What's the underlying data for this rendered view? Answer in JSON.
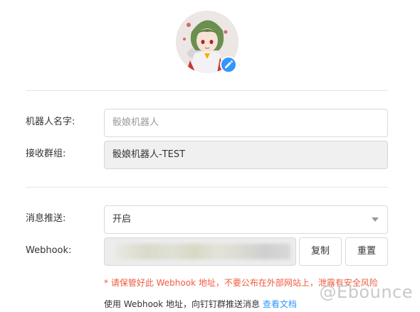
{
  "avatar": {
    "icon": "robot-avatar",
    "edit_icon": "pencil-icon"
  },
  "form": {
    "name": {
      "label": "机器人名字:",
      "placeholder": "骰娘机器人",
      "value": ""
    },
    "group": {
      "label": "接收群组:",
      "value": "骰娘机器人-TEST"
    },
    "push": {
      "label": "消息推送:",
      "value": "开启"
    },
    "webhook": {
      "label": "Webhook:",
      "copy_label": "复制",
      "reset_label": "重置",
      "warning": "* 请保管好此 Webhook 地址，不要公布在外部网站上，泄露有安全风险",
      "hint_prefix": "使用 Webhook 地址，向钉钉群推送消息 ",
      "hint_link": "查看文档"
    }
  },
  "watermark": "@Ebounce",
  "colors": {
    "accent": "#3296fa",
    "warning": "#f05b3e"
  }
}
